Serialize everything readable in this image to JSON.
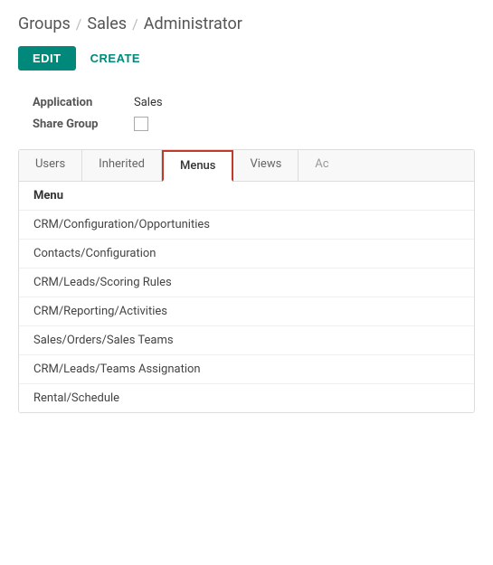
{
  "breadcrumb": {
    "parts": [
      {
        "label": "Groups"
      },
      {
        "label": "Sales"
      },
      {
        "label": "Administrator"
      }
    ],
    "separators": [
      "/",
      "/"
    ]
  },
  "toolbar": {
    "edit_label": "EDIT",
    "create_label": "CReatE"
  },
  "form": {
    "application_label": "Application",
    "application_value": "Sales",
    "share_group_label": "Share Group"
  },
  "tabs": [
    {
      "label": "Users",
      "active": false
    },
    {
      "label": "Inherited",
      "active": false
    },
    {
      "label": "Menus",
      "active": true
    },
    {
      "label": "Views",
      "active": false
    },
    {
      "label": "Ac",
      "active": false,
      "truncated": true
    }
  ],
  "table": {
    "column_header": "Menu",
    "rows": [
      {
        "value": "CRM/Configuration/Opportunities"
      },
      {
        "value": "Contacts/Configuration"
      },
      {
        "value": "CRM/Leads/Scoring Rules"
      },
      {
        "value": "CRM/Reporting/Activities"
      },
      {
        "value": "Sales/Orders/Sales Teams"
      },
      {
        "value": "CRM/Leads/Teams Assignation"
      },
      {
        "value": "Rental/Schedule"
      }
    ]
  },
  "colors": {
    "teal": "#00897b",
    "active_tab_border": "#c0392b"
  }
}
